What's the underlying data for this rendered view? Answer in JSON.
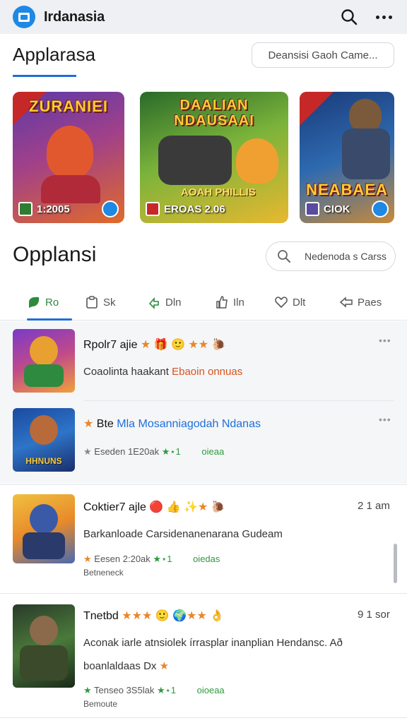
{
  "app": {
    "title": "Irdanasia",
    "search_icon": "search-icon",
    "more_icon": "more-horizontal-icon"
  },
  "section1": {
    "title": "Applarasa",
    "search_placeholder": "Deansisi Gaoh Came..."
  },
  "banners": [
    {
      "title": "ZURANIEI",
      "count": "1:2005"
    },
    {
      "title": "DAALIAN NDAUSAAI",
      "count": "EROAS 2.06",
      "caption": "AOAH PHILLIS"
    },
    {
      "title": "NEABAEA",
      "count": "CIOK"
    }
  ],
  "section2": {
    "title": "Opplansi",
    "search_placeholder": "Nedenoda s Carss"
  },
  "tabs": [
    {
      "label": "Ro",
      "icon": "chat-leaf-icon",
      "active": true
    },
    {
      "label": "Sk",
      "icon": "clipboard-icon",
      "active": false
    },
    {
      "label": "Dln",
      "icon": "refresh-arrow-icon",
      "active": false
    },
    {
      "label": "Iln",
      "icon": "thumbs-up-icon",
      "active": false
    },
    {
      "label": "Dlt",
      "icon": "heart-icon",
      "active": false
    },
    {
      "label": "Paes",
      "icon": "share-icon",
      "active": false
    }
  ],
  "items": [
    {
      "name": "Rpolr7 ajie",
      "emojis": "★ 🎁 🙂 ★★ 🐌",
      "line2a": "Coaolinta haakant",
      "line2b": "Ebaoin onnuas",
      "dots": "•••"
    },
    {
      "name": "Bte",
      "line1b": "Mla",
      "line1c": "Mosanniagodah",
      "line1d": "Ndanas",
      "stats": "Eseden 1E20ak",
      "stars": "★⋆1",
      "tag": "oieaa",
      "thumb_caption": "HHNUNS",
      "dots": "•••"
    },
    {
      "name": "Coktier7 ajle",
      "emojis": "🔴 👍 ✨★ 🐌",
      "line2": "Barkanloade Carsidenanenarana Gudeam",
      "stats": "Eesen 2:20ak",
      "stars": "★⋆1",
      "tag": "oiedas",
      "sub": "Betneneck",
      "time": "2 1 am"
    },
    {
      "name": "Tnetbd",
      "emojis": "★★★ 🙂 🌍★★ 👌",
      "line2": "Aconak iarle atnsiolek írrasplar inanplian Hendansc. Að",
      "line3": "boanlaldaas Dx",
      "stats": "Tenseo 3S5lak",
      "stars": "★⋆1",
      "tag": "oioeaa",
      "sub": "Bemoute",
      "time": "9 1 sor"
    }
  ],
  "colors": {
    "accent": "#1e6fd9",
    "active_tab": "#2e8b3e",
    "app_bar": "#eef0f3"
  }
}
